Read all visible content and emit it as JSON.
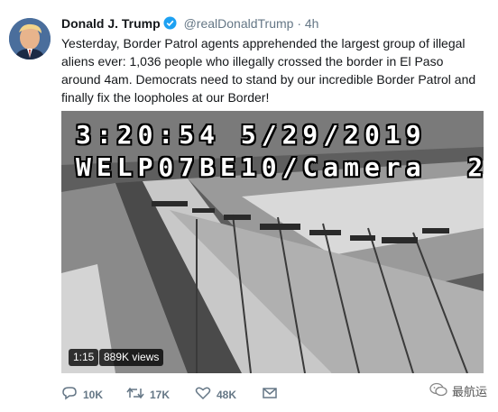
{
  "tweet": {
    "author_name": "Donald J. Trump",
    "handle": "@realDonaldTrump",
    "separator": "·",
    "time": "4h",
    "text": "Yesterday, Border Patrol agents apprehended the largest group of illegal aliens ever: 1,036 people who illegally crossed the border in El Paso around 4am. Democrats need to stand by our incredible Border Patrol and finally fix the loopholes at our Border!"
  },
  "video": {
    "timestamp_line": "3:20:54 5/29/2019",
    "camera_line": "WELP07BE10/Camera  2",
    "duration": "1:15",
    "views": "889K views"
  },
  "actions": {
    "replies": "10K",
    "retweets": "17K",
    "likes": "48K"
  },
  "watermark": {
    "text": "最航运"
  },
  "colors": {
    "text": "#14171a",
    "secondary": "#657786",
    "verified": "#1da1f2"
  }
}
